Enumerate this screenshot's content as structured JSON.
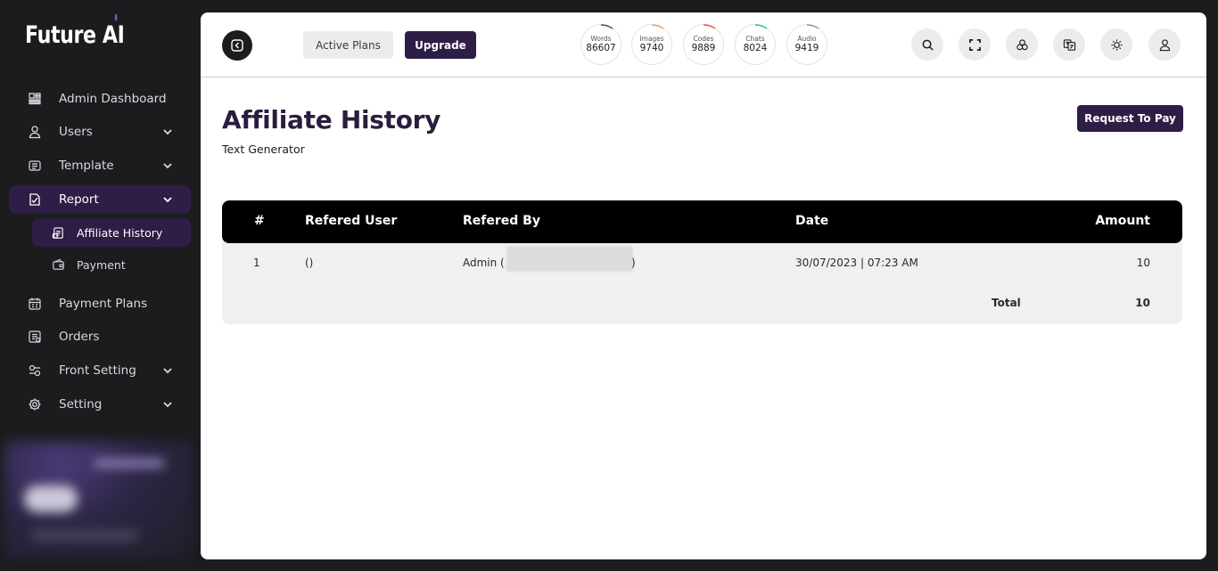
{
  "app": {
    "logo_text_main": "Future",
    "logo_text_accent": "AI"
  },
  "sidebar": {
    "items": [
      {
        "label": "Admin Dashboard",
        "icon": "dashboard-icon"
      },
      {
        "label": "Users",
        "icon": "user-icon",
        "expandable": true
      },
      {
        "label": "Template",
        "icon": "template-icon",
        "expandable": true
      },
      {
        "label": "Report",
        "icon": "report-icon",
        "expandable": true,
        "active": true
      },
      {
        "label": "Payment Plans",
        "icon": "calendar-icon"
      },
      {
        "label": "Orders",
        "icon": "orders-icon"
      },
      {
        "label": "Front Setting",
        "icon": "front-setting-icon",
        "expandable": true
      },
      {
        "label": "Setting",
        "icon": "gear-icon",
        "expandable": true
      }
    ],
    "report_sub": [
      {
        "label": "Affiliate History",
        "icon": "affiliate-icon",
        "active": true
      },
      {
        "label": "Payment",
        "icon": "wallet-icon"
      }
    ]
  },
  "topbar": {
    "active_plans_label": "Active Plans",
    "upgrade_label": "Upgrade",
    "stats": [
      {
        "label": "Words",
        "value": "86607",
        "color": "#555555"
      },
      {
        "label": "Images",
        "value": "9740",
        "color": "#f0a060"
      },
      {
        "label": "Codes",
        "value": "9889",
        "color": "#e0604a"
      },
      {
        "label": "Chats",
        "value": "8024",
        "color": "#3fb8a8"
      },
      {
        "label": "Audio",
        "value": "9419",
        "color": "#a0a070"
      }
    ],
    "tools": [
      "search-icon",
      "fullscreen-icon",
      "apps-icon",
      "translate-icon",
      "sun-icon",
      "profile-icon"
    ]
  },
  "page": {
    "title": "Affiliate History",
    "subtitle": "Text Generator",
    "request_label": "Request To Pay"
  },
  "table": {
    "headers": [
      "#",
      "Refered User",
      "Refered By",
      "Date",
      "Amount"
    ],
    "rows": [
      {
        "index": "1",
        "user": "()",
        "by_prefix": "Admin (",
        "by_suffix": ")",
        "date": "30/07/2023 | 07:23 AM",
        "amount": "10"
      }
    ],
    "total_label": "Total",
    "total_value": "10"
  },
  "colors": {
    "accent": "#2e1d45",
    "sidebar_bg": "#1c1c1f",
    "header_bg": "#000000"
  }
}
